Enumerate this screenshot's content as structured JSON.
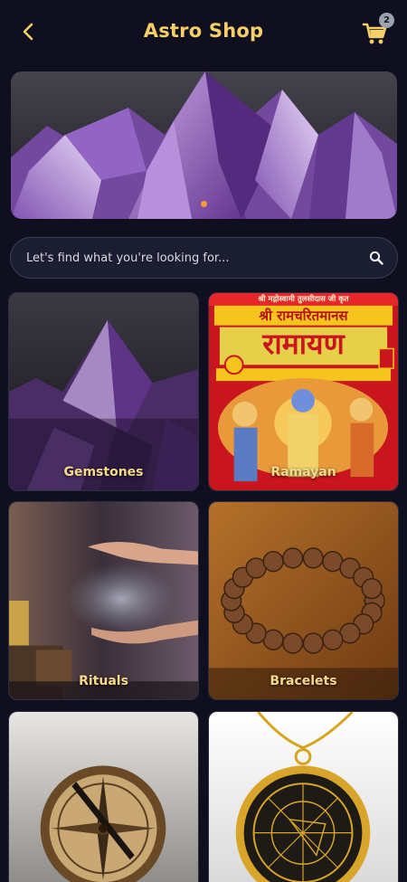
{
  "header": {
    "title": "Astro Shop",
    "cart_count": "2"
  },
  "search": {
    "placeholder": "Let's find what you're looking for..."
  },
  "categories": [
    {
      "label": "Gemstones"
    },
    {
      "label": "Ramayan"
    },
    {
      "label": "Rituals"
    },
    {
      "label": "Bracelets"
    },
    {
      "label": ""
    },
    {
      "label": ""
    }
  ],
  "ramayan_cover": {
    "top_line": "श्री मद्गोस्वामी तुलसीदास जी कृत",
    "subtitle": "श्री रामचरितमानस",
    "main": "रामायण"
  },
  "colors": {
    "background": "#0f0f1f",
    "accent": "#f5cf6a",
    "banner_dot": "#f29a3a"
  }
}
